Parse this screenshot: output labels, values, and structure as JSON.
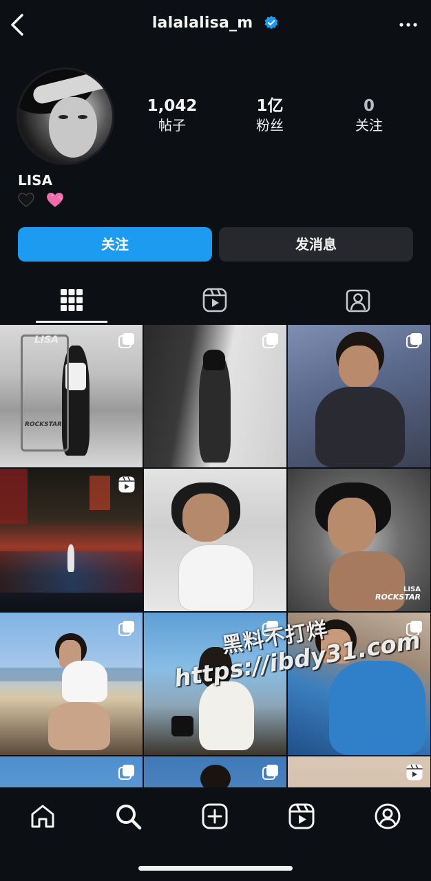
{
  "header": {
    "username": "lalalalisa_m",
    "icons": {
      "back": "chevron-left-icon",
      "verified": "verified-badge-icon",
      "more": "more-horizontal-icon"
    },
    "verified_color": "#1d9bf0"
  },
  "profile": {
    "stats": [
      {
        "value": "1,042",
        "label": "帖子"
      },
      {
        "value": "1亿",
        "label": "粉丝"
      },
      {
        "value": "0",
        "label": "关注"
      }
    ],
    "display_name": "LISA",
    "bio_emojis": [
      "black-heart",
      "pink-heart"
    ]
  },
  "actions": {
    "follow_label": "关注",
    "follow_color": "#1d9bf0",
    "message_label": "发消息"
  },
  "tabs": [
    {
      "name": "posts-grid",
      "icon": "grid-icon",
      "active": true
    },
    {
      "name": "reels",
      "icon": "reels-icon",
      "active": false
    },
    {
      "name": "tagged",
      "icon": "tagged-person-icon",
      "active": false
    }
  ],
  "grid": {
    "posts": [
      {
        "badge": "multi-photo-icon"
      },
      {
        "badge": "multi-photo-icon"
      },
      {
        "badge": "multi-photo-icon"
      },
      {
        "badge": "reel-icon"
      },
      {
        "badge": ""
      },
      {
        "badge": ""
      },
      {
        "badge": "multi-photo-icon"
      },
      {
        "badge": "multi-photo-icon"
      },
      {
        "badge": "multi-photo-icon"
      },
      {
        "badge": "multi-photo-icon"
      },
      {
        "badge": "multi-photo-icon"
      },
      {
        "badge": "reel-icon"
      }
    ],
    "overlay_texts": {
      "cell1_sign": "LISA",
      "cell1_rack": "ROCKSTAR",
      "cell6_line1": "LISA",
      "cell6_line2": "ROCKSTAR"
    }
  },
  "watermark": {
    "line1": "黑料不打烊",
    "line2": "https://ibdy31.com"
  },
  "bottom_nav": [
    {
      "name": "home",
      "icon": "home-icon"
    },
    {
      "name": "search",
      "icon": "search-icon"
    },
    {
      "name": "create",
      "icon": "add-square-icon"
    },
    {
      "name": "reels",
      "icon": "reels-icon"
    },
    {
      "name": "profile",
      "icon": "profile-icon"
    }
  ]
}
